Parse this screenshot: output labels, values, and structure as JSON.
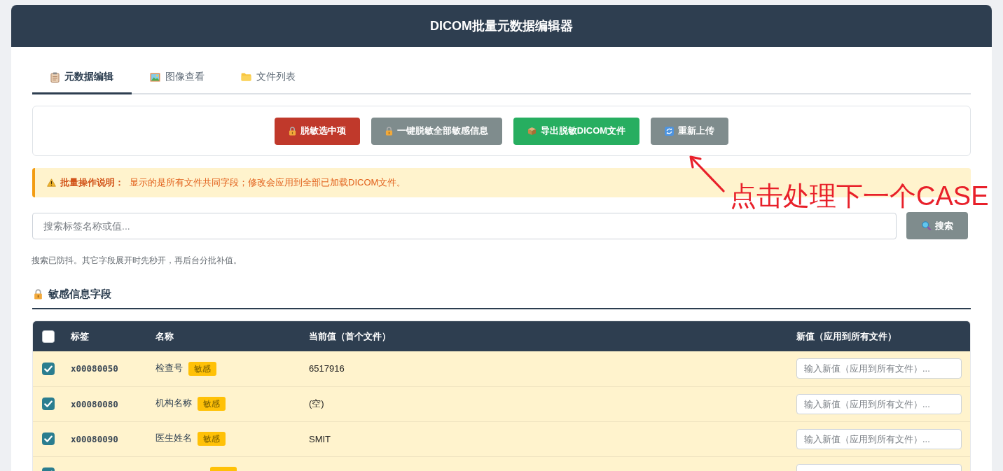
{
  "header": {
    "title": "DICOM批量元数据编辑器"
  },
  "tabs": [
    {
      "label": "元数据编辑",
      "selected": true
    },
    {
      "label": "图像查看",
      "selected": false
    },
    {
      "label": "文件列表",
      "selected": false
    }
  ],
  "toolbar": {
    "buttons": [
      {
        "label": "脱敏选中项",
        "kind": "danger"
      },
      {
        "label": "一键脱敏全部敏感信息",
        "kind": "secondary"
      },
      {
        "label": "导出脱敏DICOM文件",
        "kind": "success"
      },
      {
        "label": "重新上传",
        "kind": "secondary"
      }
    ]
  },
  "notice": {
    "label": "批量操作说明：",
    "text": "显示的是所有文件共同字段；修改会应用到全部已加载DICOM文件。"
  },
  "search": {
    "placeholder": "搜索标签名称或值...",
    "button": "搜索"
  },
  "hint": "搜索已防抖。其它字段展开时先秒开，再后台分批补值。",
  "section": {
    "title": "敏感信息字段"
  },
  "table": {
    "select_all_checked": false,
    "columns": [
      "标签",
      "名称",
      "当前值（首个文件）",
      "新值（应用到所有文件）"
    ],
    "rows": [
      {
        "checked": true,
        "sensitive": true,
        "tag": "x00080050",
        "name": "检查号",
        "badge": "敏感",
        "value": "6517916",
        "placeholder": "输入新值（应用到所有文件）..."
      },
      {
        "checked": true,
        "sensitive": true,
        "tag": "x00080080",
        "name": "机构名称",
        "badge": "敏感",
        "value": "(空)",
        "placeholder": "输入新值（应用到所有文件）..."
      },
      {
        "checked": true,
        "sensitive": true,
        "tag": "x00080090",
        "name": "医生姓名",
        "badge": "敏感",
        "value": "SMIT",
        "placeholder": "输入新值（应用到所有文件）..."
      },
      {
        "checked": true,
        "sensitive": true
      }
    ]
  },
  "annotation": {
    "text": "点击处理下一个CASE"
  }
}
